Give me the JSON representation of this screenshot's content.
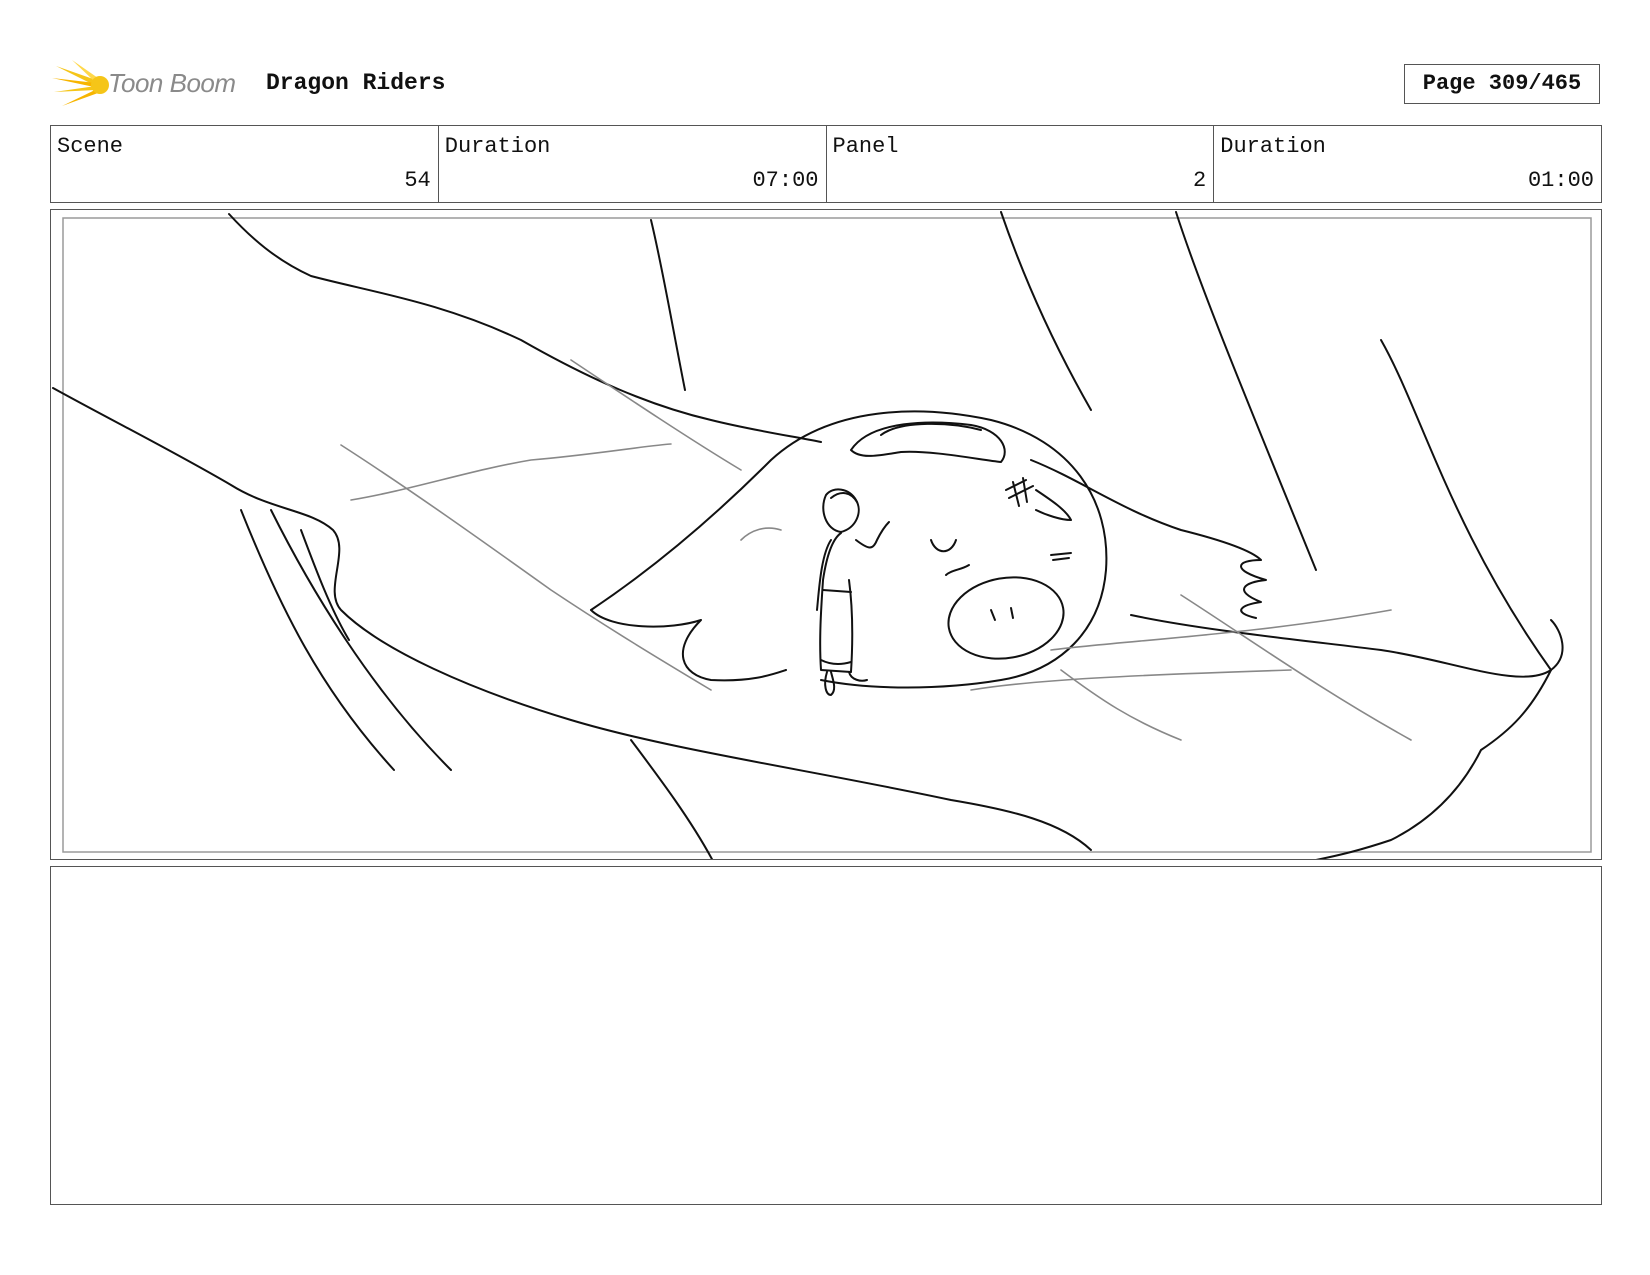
{
  "header": {
    "logo_text": "Toon Boom",
    "project_title": "Dragon Riders",
    "page_label": "Page 309/465"
  },
  "info": {
    "scene_label": "Scene",
    "scene_value": "54",
    "scene_duration_label": "Duration",
    "scene_duration_value": "07:00",
    "panel_label": "Panel",
    "panel_value": "2",
    "panel_duration_label": "Duration",
    "panel_duration_value": "01:00"
  },
  "notes": {
    "text": ""
  },
  "colors": {
    "logo_accent": "#f5c518",
    "logo_text": "#8a8a8a",
    "border": "#555555"
  }
}
